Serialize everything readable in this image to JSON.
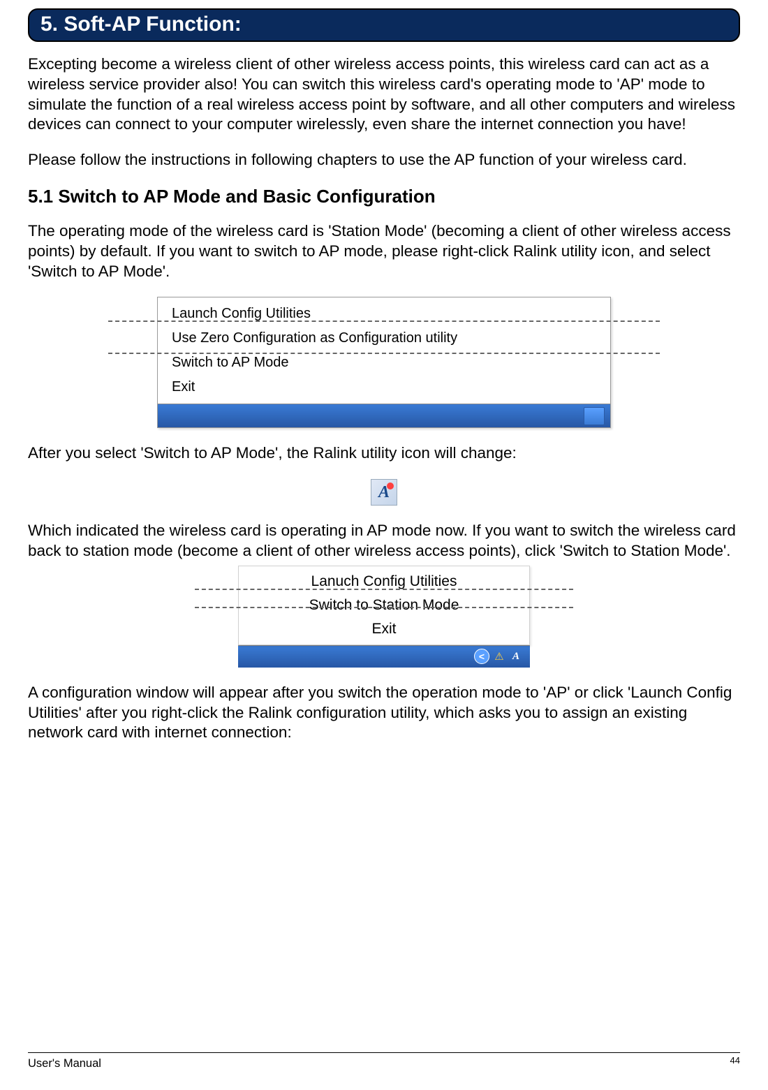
{
  "section": {
    "number_title": "5. Soft-AP Function:"
  },
  "paragraphs": {
    "intro1": "Excepting become a wireless client of other wireless access points, this wireless card can act as a wireless service provider also! You can switch this wireless card's operating mode to 'AP' mode to simulate the function of a real wireless access point by software, and all other computers and wireless devices can connect to your computer wirelessly, even share the internet connection you have!",
    "intro2": "Please follow the instructions in following chapters to use the AP function of your wireless card.",
    "sub_5_1": "5.1 Switch to AP Mode and Basic Configuration",
    "p3": "The operating mode of the wireless card is 'Station Mode' (becoming a client of other wireless access points) by default. If you want to switch to AP mode, please right-click Ralink utility icon, and select 'Switch to AP Mode'.",
    "p4": "After you select 'Switch to AP Mode', the Ralink utility icon will change:",
    "p5": "Which indicated the wireless card is operating in AP mode now. If you want to switch the wireless card back to station mode (become a client of other wireless access points), click 'Switch to Station Mode'.",
    "p6": "A configuration window will appear after you switch the operation mode to 'AP' or click 'Launch Config Utilities' after you right-click the Ralink configuration utility, which asks you to assign an existing network card with internet connection:"
  },
  "menu1": {
    "items": [
      "Launch Config Utilities",
      "Use Zero Configuration as Configuration utility",
      "Switch to AP Mode",
      "Exit"
    ]
  },
  "menu2": {
    "items": [
      "Lanuch Config Utilities",
      "Switch to Station Mode",
      "Exit"
    ]
  },
  "icons": {
    "ap_glyph": "A"
  },
  "footer": {
    "left": "User's Manual",
    "page": "44"
  }
}
